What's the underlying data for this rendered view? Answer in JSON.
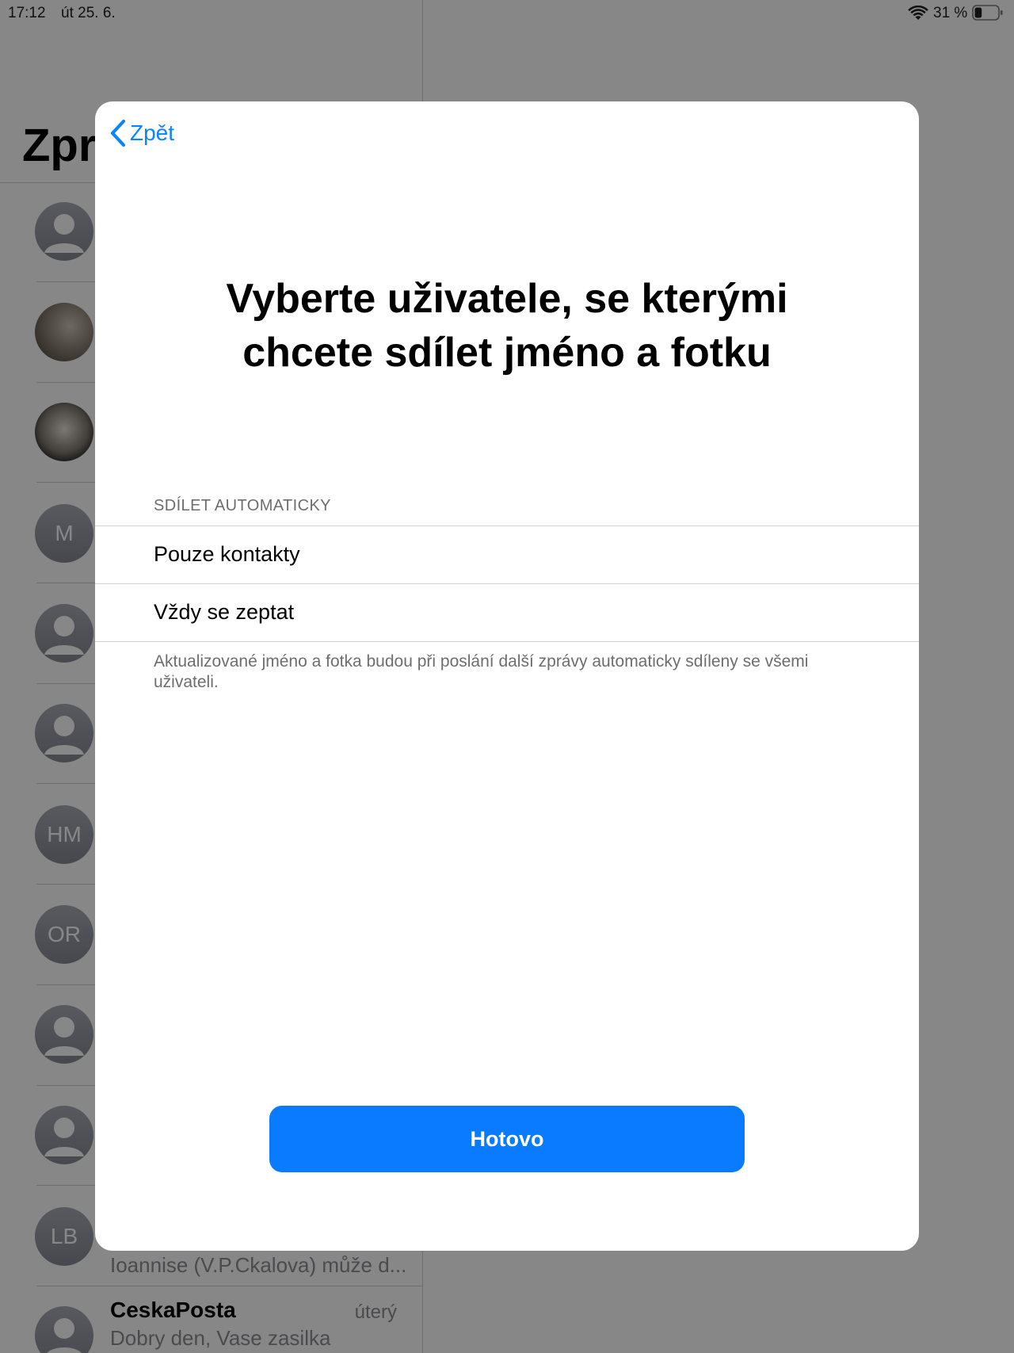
{
  "status_bar": {
    "time": "17:12",
    "date": "út 25. 6.",
    "battery_percent": "31 %",
    "battery_level": 0.31
  },
  "messages": {
    "title": "Zpr",
    "avatars": [
      {
        "type": "person-icon",
        "initials": ""
      },
      {
        "type": "photo",
        "initials": ""
      },
      {
        "type": "photo",
        "initials": ""
      },
      {
        "type": "initials",
        "initials": "M"
      },
      {
        "type": "person-icon",
        "initials": ""
      },
      {
        "type": "person-icon",
        "initials": ""
      },
      {
        "type": "initials",
        "initials": "HM"
      },
      {
        "type": "initials",
        "initials": "OR"
      },
      {
        "type": "person-icon",
        "initials": ""
      },
      {
        "type": "person-icon",
        "initials": ""
      },
      {
        "type": "initials",
        "initials": "LB"
      },
      {
        "type": "person-icon",
        "initials": ""
      }
    ],
    "partial_preview": "Ioannise (V.P.Ckalova) může d...",
    "last_row": {
      "name": "CeskaPosta",
      "time": "úterý",
      "preview": "Dobry den, Vase zasilka"
    }
  },
  "modal": {
    "back_label": "Zpět",
    "title_line1": "Vyberte uživatele, se kterými",
    "title_line2": "chcete sdílet jméno a fotku",
    "section_header": "SDÍLET AUTOMATICKY",
    "options": [
      "Pouze kontakty",
      "Vždy se zeptat"
    ],
    "footer": "Aktualizované jméno a fotka budou při poslání další zprávy automaticky sdíleny se všemi uživateli.",
    "done_label": "Hotovo"
  },
  "colors": {
    "accent": "#0a84ff",
    "done_button": "#0a7aff",
    "dim_overlay": "rgba(0,0,0,0.47)"
  }
}
